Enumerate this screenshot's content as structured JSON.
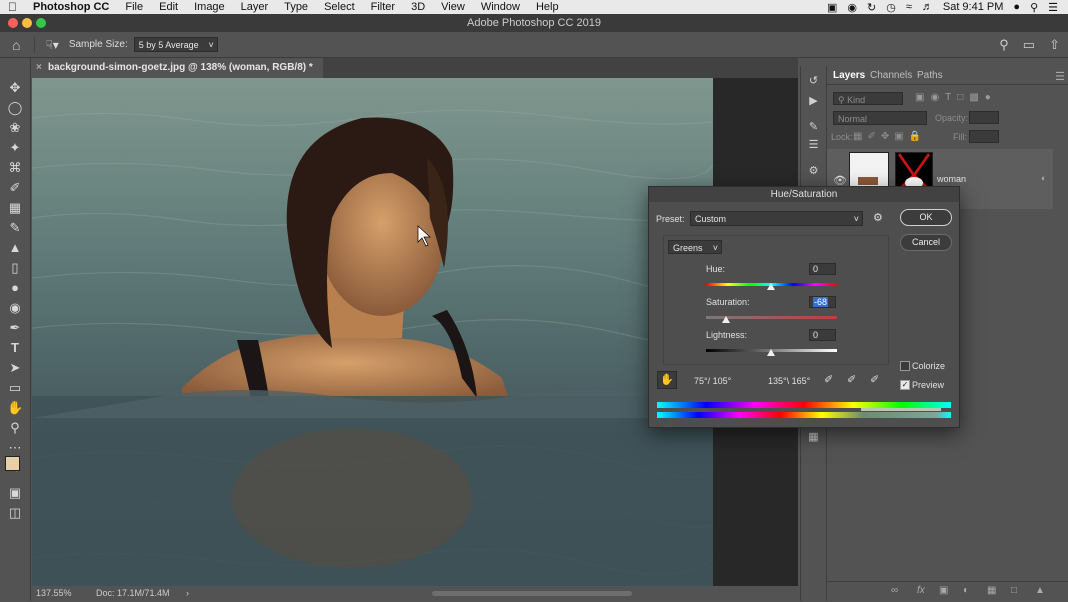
{
  "menubar": {
    "apple": "",
    "app_name": "Photoshop CC",
    "items": [
      "File",
      "Edit",
      "Image",
      "Layer",
      "Type",
      "Select",
      "Filter",
      "3D",
      "View",
      "Window",
      "Help"
    ],
    "clock": "Sat 9:41 PM"
  },
  "window": {
    "title": "Adobe Photoshop CC 2019"
  },
  "options_bar": {
    "sample_size_label": "Sample Size:",
    "sample_size_value": "5 by 5 Average"
  },
  "document": {
    "tab_title": "background-simon-goetz.jpg @ 138% (woman, RGB/8) *"
  },
  "status": {
    "zoom": "137.55%",
    "doc": "Doc: 17.1M/71.4M",
    "arrow": "›"
  },
  "layers_panel": {
    "tabs": [
      "Layers",
      "Channels",
      "Paths"
    ],
    "kind_placeholder": "Kind",
    "blend_mode": "Normal",
    "opacity_label": "Opacity:",
    "lock_label": "Lock:",
    "fill_label": "Fill:",
    "layer_name": "woman"
  },
  "dialog": {
    "title": "Hue/Saturation",
    "preset_label": "Preset:",
    "preset_value": "Custom",
    "ok": "OK",
    "cancel": "Cancel",
    "channel": "Greens",
    "hue_label": "Hue:",
    "hue_value": "0",
    "saturation_label": "Saturation:",
    "saturation_value": "-68",
    "lightness_label": "Lightness:",
    "lightness_value": "0",
    "colorize_label": "Colorize",
    "colorize_checked": false,
    "preview_label": "Preview",
    "preview_checked": true,
    "range_left": "75°/ 105°",
    "range_right": "135°\\ 165°"
  },
  "colors": {
    "foreground": "#e8cfa6",
    "background": "#ffffff",
    "accent": "#2f6fd6"
  }
}
